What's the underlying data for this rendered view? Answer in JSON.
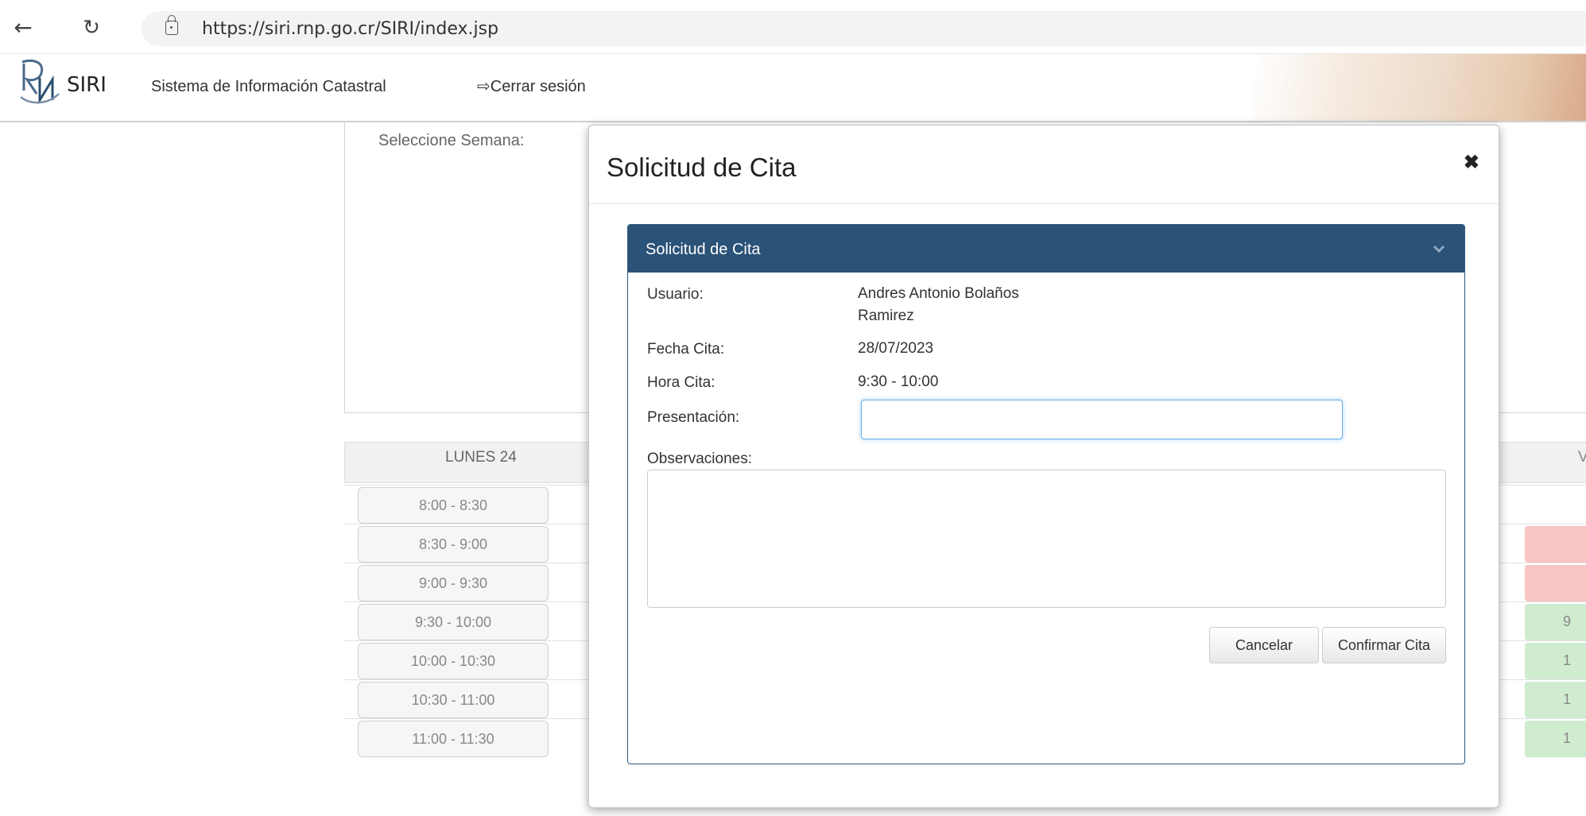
{
  "browser": {
    "url": "https://siri.rnp.go.cr/SIRI/index.jsp"
  },
  "header": {
    "brand": "SIRI",
    "title": "Sistema de Información Catastral",
    "logout_label": "Cerrar sesión"
  },
  "schedule": {
    "week_label": "Seleccione Semana:",
    "day_label": "LUNES 24",
    "next_day_initial": "V",
    "slots": [
      "8:00 - 8:30",
      "8:30 - 9:00",
      "9:00 - 9:30",
      "9:30 - 10:00",
      "10:00 - 10:30",
      "10:30 - 11:00",
      "11:00 - 11:30"
    ],
    "edge_slots": [
      "",
      "",
      "",
      "9",
      "1",
      "1",
      "1"
    ]
  },
  "modal": {
    "title": "Solicitud de Cita",
    "panel_title": "Solicitud de Cita",
    "fields": {
      "usuario_label": "Usuario:",
      "usuario_line1": "Andres Antonio Bolaños",
      "usuario_line2": "Ramirez",
      "fecha_label": "Fecha Cita:",
      "fecha_value": "28/07/2023",
      "hora_label": "Hora Cita:",
      "hora_value": "9:30 - 10:00",
      "presentacion_label": "Presentación:",
      "presentacion_value": "",
      "observaciones_label": "Observaciones:",
      "observaciones_value": ""
    },
    "buttons": {
      "cancel": "Cancelar",
      "confirm": "Confirmar Cita"
    }
  },
  "colors": {
    "panel_header": "#2b5277",
    "slot_taken": "#f7c5c4",
    "slot_free": "#cfeccf"
  }
}
